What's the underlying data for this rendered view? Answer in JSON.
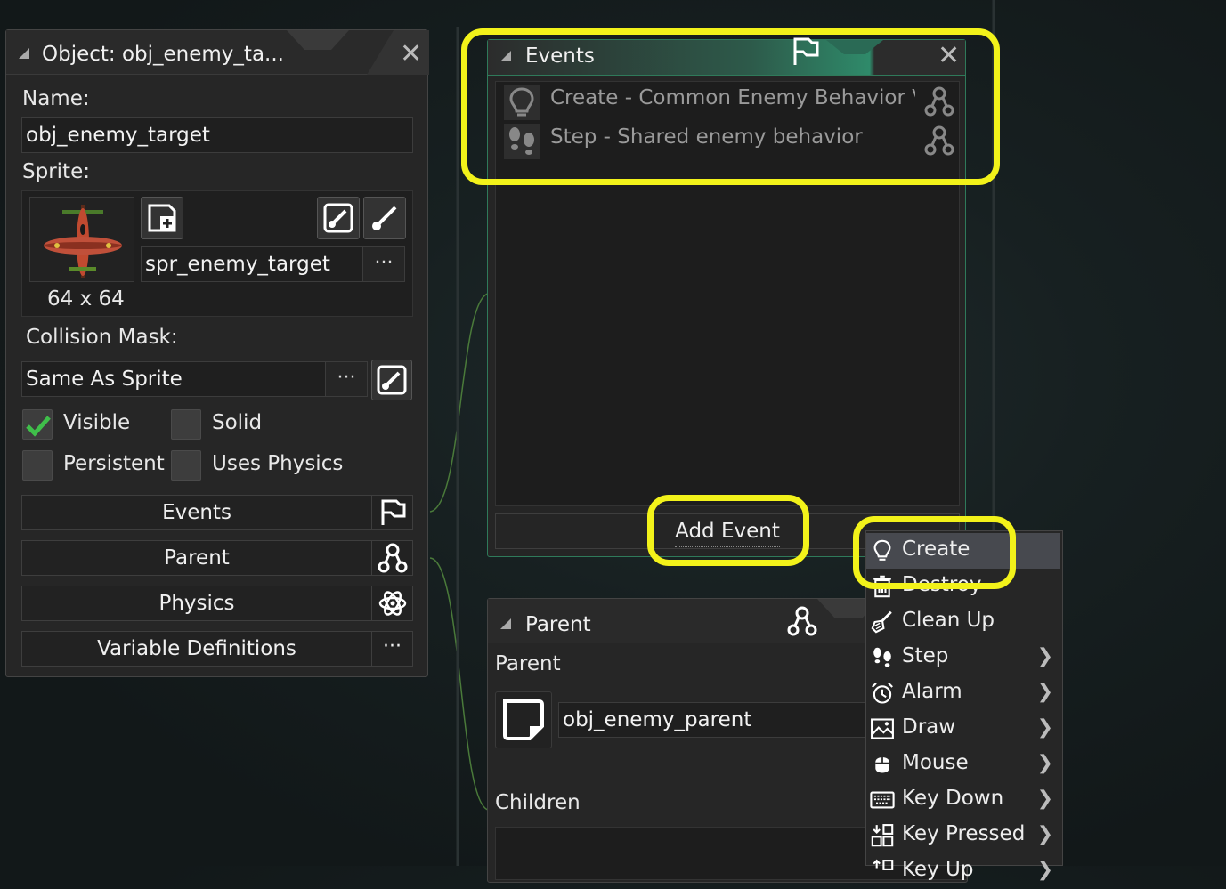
{
  "object_panel": {
    "title": "Object: obj_enemy_ta...",
    "name_label": "Name:",
    "name_value": "obj_enemy_target",
    "sprite_label": "Sprite:",
    "sprite_name": "spr_enemy_target",
    "sprite_size": "64 x 64",
    "dots": "···",
    "collision_label": "Collision Mask:",
    "collision_value": "Same As Sprite",
    "visible_label": "Visible",
    "solid_label": "Solid",
    "persistent_label": "Persistent",
    "uses_physics_label": "Uses Physics",
    "visible_checked": true,
    "solid_checked": false,
    "persistent_checked": false,
    "uses_physics_checked": false,
    "buttons": {
      "events": "Events",
      "parent": "Parent",
      "physics": "Physics",
      "variable_definitions": "Variable Definitions"
    }
  },
  "events_panel": {
    "title": "Events",
    "events": [
      {
        "label": "Create - Common Enemy Behavior Va",
        "icon": "lightbulb-icon"
      },
      {
        "label": "Step - Shared enemy behavior",
        "icon": "footsteps-icon"
      }
    ],
    "add_event_label": "Add Event"
  },
  "parent_panel": {
    "title": "Parent",
    "parent_label": "Parent",
    "parent_value": "obj_enemy_parent",
    "children_label": "Children"
  },
  "event_menu": {
    "items": [
      {
        "label": "Create",
        "icon": "lightbulb-icon",
        "submenu": false
      },
      {
        "label": "Destroy",
        "icon": "trash-icon",
        "submenu": false
      },
      {
        "label": "Clean Up",
        "icon": "broom-icon",
        "submenu": false
      },
      {
        "label": "Step",
        "icon": "footsteps-icon",
        "submenu": true
      },
      {
        "label": "Alarm",
        "icon": "alarm-clock-icon",
        "submenu": true
      },
      {
        "label": "Draw",
        "icon": "picture-icon",
        "submenu": true
      },
      {
        "label": "Mouse",
        "icon": "mouse-icon",
        "submenu": true
      },
      {
        "label": "Key Down",
        "icon": "keyboard-icon",
        "submenu": true
      },
      {
        "label": "Key Pressed",
        "icon": "key-pressed-icon",
        "submenu": true
      },
      {
        "label": "Key Up",
        "icon": "key-up-icon",
        "submenu": true
      }
    ]
  },
  "colors": {
    "highlight": "#f2f21a",
    "events_header_accent": "#2f8a6a",
    "check_green": "#3fbf4a"
  }
}
